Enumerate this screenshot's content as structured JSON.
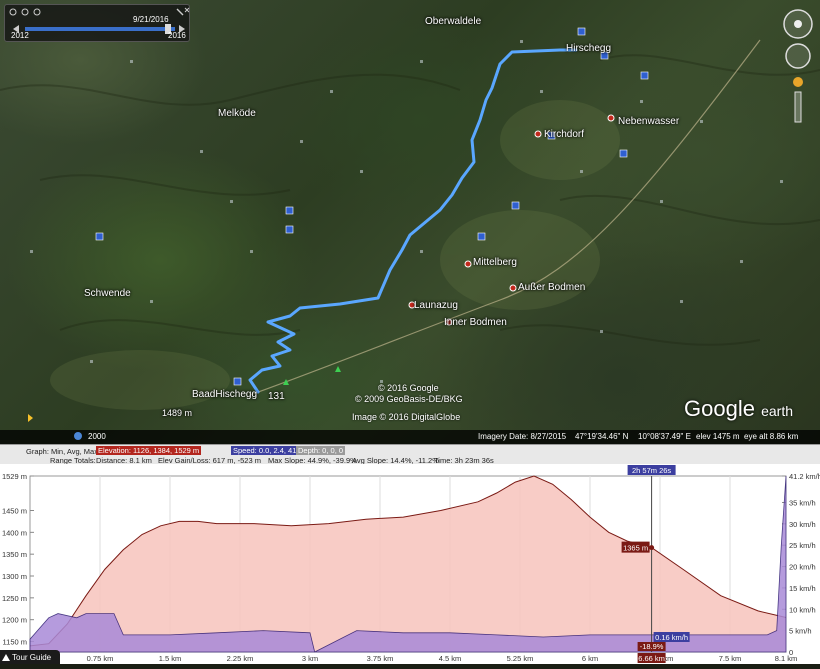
{
  "timeline": {
    "date": "9/21/2016",
    "start_year": "2012",
    "end_year": "2016"
  },
  "map": {
    "places": [
      "Oberwaldele",
      "Hirschegg",
      "Melköde",
      "Nebenwasser",
      "Kirchdorf",
      "Mittelberg",
      "Schwende",
      "Außer Bodmen",
      "Launazug",
      "Inner Bodmen",
      "BaadHischegg",
      "131",
      "1489 m"
    ],
    "credits": [
      "© 2016 Google",
      "© 2009 GeoBasis-DE/BKG",
      "Image © 2016 DigitalGlobe"
    ],
    "logo": {
      "main": "Google",
      "sub": "earth"
    }
  },
  "status": {
    "year": "2000",
    "imagery_date": "Imagery Date: 8/27/2015",
    "lat": "47°19'34.46\" N",
    "lon": "10°08'37.49\" E",
    "elev": "elev  1475 m",
    "eye_alt": "eye alt   8.86 km"
  },
  "info": {
    "graph_label": "Graph: Min, Avg, Max",
    "elevation": "Elevation: 1126, 1384, 1529 m",
    "speed": "Speed: 0.0, 2.4, 41.2 km/h",
    "depth": "Depth: 0, 0, 0",
    "range_totals": "Range Totals:",
    "distance": "Distance: 8.1 km",
    "elev_gain": "Elev Gain/Loss: 617 m, -523 m",
    "max_slope": "Max Slope: 44.9%, -39.9%",
    "avg_slope": "Avg Slope: 14.4%, -11.2%",
    "time": "Time: 3h 23m 36s"
  },
  "tour_guide": "Tour Guide",
  "chart_data": {
    "type": "area",
    "xlabel": "",
    "ylabel": "",
    "xlim": [
      0,
      8.1
    ],
    "ylim_left": [
      1126,
      1529
    ],
    "ylim_right": [
      0,
      41.2
    ],
    "x_ticks": [
      "0.75 km",
      "1.5 km",
      "2.25 km",
      "3 km",
      "3.75 km",
      "4.5 km",
      "5.25 km",
      "6 km",
      "6.75 km",
      "7.5 km",
      "8.1 km"
    ],
    "x_tick_values": [
      0.75,
      1.5,
      2.25,
      3,
      3.75,
      4.5,
      5.25,
      6,
      6.75,
      7.5,
      8.1
    ],
    "y_left_ticks": [
      "1529 m",
      "1450 m",
      "1400 m",
      "1350 m",
      "1300 m",
      "1250 m",
      "1200 m",
      "1150 m",
      "1126 m"
    ],
    "y_left_values": [
      1529,
      1450,
      1400,
      1350,
      1300,
      1250,
      1200,
      1150,
      1126
    ],
    "y_right_ticks": [
      "41.2 km/h",
      "35 km/h",
      "30 km/h",
      "25 km/h",
      "20 km/h",
      "15 km/h",
      "10 km/h",
      "5 km/h",
      "0"
    ],
    "y_right_values": [
      41.2,
      35,
      30,
      25,
      20,
      15,
      10,
      5,
      0
    ],
    "series": [
      {
        "name": "Elevation",
        "unit": "m",
        "x": [
          0,
          0.2,
          0.4,
          0.6,
          0.8,
          1.0,
          1.2,
          1.4,
          1.6,
          1.8,
          2.0,
          2.4,
          2.8,
          3.2,
          3.6,
          4.0,
          4.4,
          4.8,
          5.0,
          5.2,
          5.4,
          5.6,
          5.8,
          6.0,
          6.2,
          6.4,
          6.66,
          7.0,
          7.4,
          7.8,
          8.1
        ],
        "values": [
          1140,
          1145,
          1190,
          1255,
          1315,
          1360,
          1395,
          1415,
          1425,
          1425,
          1420,
          1420,
          1415,
          1420,
          1430,
          1435,
          1450,
          1470,
          1490,
          1515,
          1529,
          1510,
          1475,
          1435,
          1400,
          1380,
          1365,
          1315,
          1255,
          1220,
          1205
        ]
      },
      {
        "name": "Speed",
        "unit": "km/h",
        "x": [
          0,
          0.2,
          0.3,
          0.5,
          0.6,
          0.9,
          1.0,
          1.5,
          2.0,
          2.5,
          3.0,
          3.05,
          3.5,
          4.0,
          4.5,
          5.0,
          5.5,
          6.0,
          6.5,
          7.0,
          7.5,
          7.9,
          8.0,
          8.05,
          8.1
        ],
        "values": [
          3,
          8,
          9,
          8,
          9,
          9,
          4,
          4,
          4.5,
          5,
          4.5,
          0,
          5,
          4.5,
          4.5,
          4,
          3.5,
          4,
          4,
          4,
          4,
          4,
          5,
          25,
          41.2
        ]
      }
    ],
    "cursor": {
      "elevation_label": "1365 m",
      "speed_label": "0.16 km/h",
      "distance_label": "6.66 km",
      "slope_label": "-18.9%",
      "time_label": "2h 57m 26s",
      "x": 6.66
    }
  }
}
